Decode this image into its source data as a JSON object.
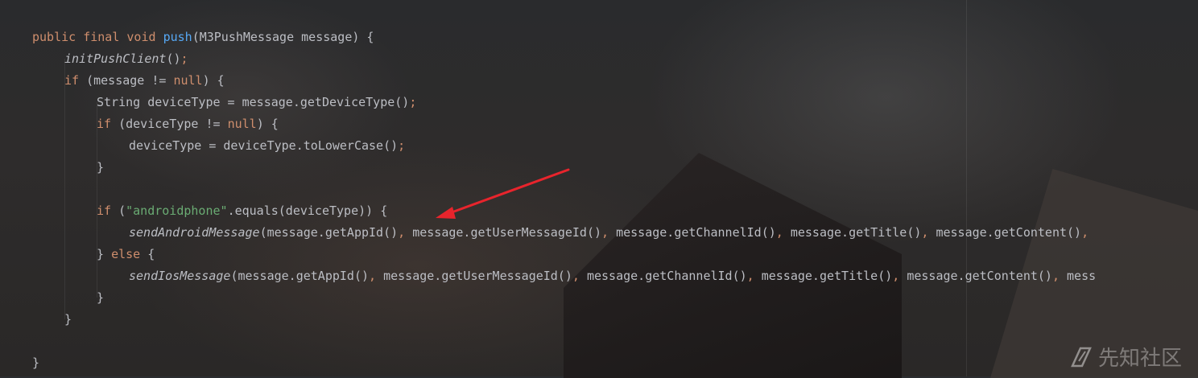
{
  "code": {
    "lines": [
      {
        "indent": 0,
        "tokens": [
          [
            "kw",
            "public final void "
          ],
          [
            "fn",
            "push"
          ],
          [
            "p",
            "(M3PushMessage message) {"
          ]
        ]
      },
      {
        "indent": 1,
        "tokens": [
          [
            "it",
            "initPushClient"
          ],
          [
            "p",
            "()"
          ],
          [
            "kw",
            ";"
          ]
        ]
      },
      {
        "indent": 1,
        "tokens": [
          [
            "kw",
            "if "
          ],
          [
            "p",
            "(message != "
          ],
          [
            "kw",
            "null"
          ],
          [
            "p",
            ") {"
          ]
        ]
      },
      {
        "indent": 2,
        "tokens": [
          [
            "p",
            "String deviceType = message.getDeviceType()"
          ],
          [
            "kw",
            ";"
          ]
        ]
      },
      {
        "indent": 2,
        "tokens": [
          [
            "kw",
            "if "
          ],
          [
            "p",
            "(deviceType != "
          ],
          [
            "kw",
            "null"
          ],
          [
            "p",
            ") {"
          ]
        ]
      },
      {
        "indent": 3,
        "tokens": [
          [
            "p",
            "deviceType = deviceType.toLowerCase()"
          ],
          [
            "kw",
            ";"
          ]
        ]
      },
      {
        "indent": 2,
        "tokens": [
          [
            "p",
            "}"
          ]
        ]
      },
      {
        "indent": 0,
        "tokens": []
      },
      {
        "indent": 2,
        "tokens": [
          [
            "kw",
            "if "
          ],
          [
            "p",
            "("
          ],
          [
            "str",
            "\"androidphone\""
          ],
          [
            "p",
            ".equals(deviceType)) {"
          ]
        ]
      },
      {
        "indent": 3,
        "tokens": [
          [
            "it",
            "sendAndroidMessage"
          ],
          [
            "p",
            "(message.getAppId()"
          ],
          [
            "kw",
            ", "
          ],
          [
            "p",
            "message.getUserMessageId()"
          ],
          [
            "kw",
            ", "
          ],
          [
            "p",
            "message.getChannelId()"
          ],
          [
            "kw",
            ", "
          ],
          [
            "p",
            "message.getTitle()"
          ],
          [
            "kw",
            ", "
          ],
          [
            "p",
            "message.getContent()"
          ],
          [
            "kw",
            ", "
          ]
        ]
      },
      {
        "indent": 2,
        "tokens": [
          [
            "p",
            "} "
          ],
          [
            "kw",
            "else "
          ],
          [
            "p",
            "{"
          ]
        ]
      },
      {
        "indent": 3,
        "tokens": [
          [
            "it",
            "sendIosMessage"
          ],
          [
            "p",
            "(message.getAppId()"
          ],
          [
            "kw",
            ", "
          ],
          [
            "p",
            "message.getUserMessageId()"
          ],
          [
            "kw",
            ", "
          ],
          [
            "p",
            "message.getChannelId()"
          ],
          [
            "kw",
            ", "
          ],
          [
            "p",
            "message.getTitle()"
          ],
          [
            "kw",
            ", "
          ],
          [
            "p",
            "message.getContent()"
          ],
          [
            "kw",
            ", "
          ],
          [
            "p",
            "mess"
          ]
        ]
      },
      {
        "indent": 2,
        "tokens": [
          [
            "p",
            "}"
          ]
        ]
      },
      {
        "indent": 1,
        "tokens": [
          [
            "p",
            "}"
          ]
        ]
      },
      {
        "indent": 0,
        "tokens": []
      },
      {
        "indent": 0,
        "tokens": [
          [
            "p",
            "}"
          ]
        ]
      }
    ]
  },
  "annotation": {
    "arrow_color": "#e8242c"
  },
  "watermark": {
    "logo_icon": "xianzhi-logo-icon",
    "text": "先知社区"
  },
  "colors": {
    "keyword": "#cf8e6d",
    "function": "#56a8f5",
    "string": "#6aab73",
    "text": "#bcbec4"
  }
}
